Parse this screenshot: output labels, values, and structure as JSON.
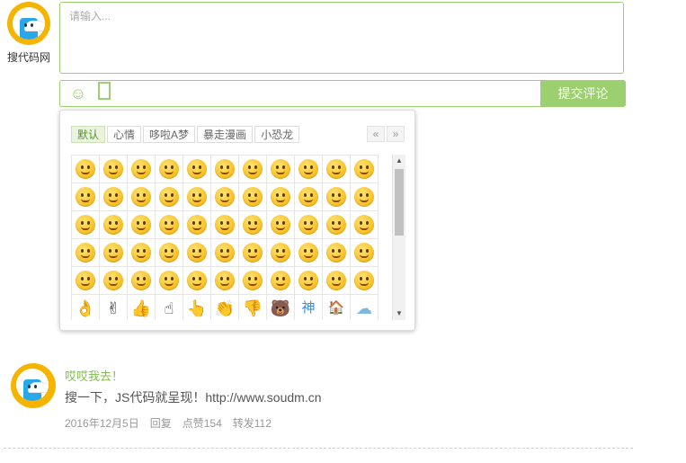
{
  "user": {
    "name": "搜代码网"
  },
  "editor": {
    "placeholder": "请输入...",
    "emoji_icon": "smile-icon",
    "submit_label": "提交评论"
  },
  "emoji_panel": {
    "tabs": [
      {
        "label": "默认",
        "active": true
      },
      {
        "label": "心情",
        "active": false
      },
      {
        "label": "哆啦A梦",
        "active": false
      },
      {
        "label": "暴走漫画",
        "active": false
      },
      {
        "label": "小恐龙",
        "active": false
      }
    ],
    "pager": {
      "prev": "«",
      "next": "»"
    },
    "last_row": [
      "👌",
      "✌",
      "👍",
      "☝",
      "👆",
      "👏",
      "👎",
      "🐻",
      "神",
      "🏠",
      "☁"
    ]
  },
  "comment": {
    "author": "哎哎我去！",
    "text": "搜一下，JS代码就呈现！http://www.soudm.cn",
    "date": "2016年12月5日",
    "reply": "回复",
    "likes": "点赞154",
    "forwards": "转发112"
  },
  "colors": {
    "accent": "#9ccf6f",
    "author": "#7fbf4d",
    "emoji": "#f7bd1f"
  }
}
